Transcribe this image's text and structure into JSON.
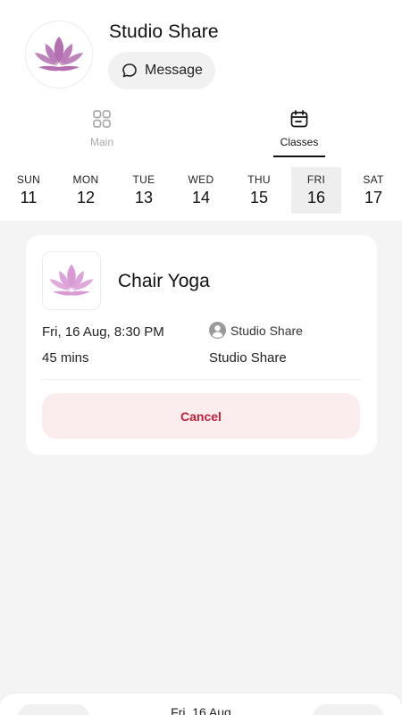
{
  "header": {
    "studio_name": "Studio Share",
    "message_label": "Message"
  },
  "tabs": [
    {
      "label": "Main",
      "icon": "grid-icon",
      "active": false
    },
    {
      "label": "Classes",
      "icon": "calendar-icon",
      "active": true
    }
  ],
  "week": [
    {
      "day": "SUN",
      "date": "11"
    },
    {
      "day": "MON",
      "date": "12"
    },
    {
      "day": "TUE",
      "date": "13"
    },
    {
      "day": "WED",
      "date": "14"
    },
    {
      "day": "THU",
      "date": "15"
    },
    {
      "day": "FRI",
      "date": "16",
      "selected": true
    },
    {
      "day": "SAT",
      "date": "17"
    }
  ],
  "class_card": {
    "title": "Chair Yoga",
    "datetime": "Fri, 16 Aug, 8:30 PM",
    "duration": "45 mins",
    "instructor": "Studio Share",
    "location": "Studio Share",
    "cancel_label": "Cancel"
  },
  "bottom_sheet": {
    "date": "Fri, 16 Aug"
  },
  "colors": {
    "brand_lotus": "#b36fb0",
    "cancel_text": "#c0213a",
    "cancel_bg": "#fbeded",
    "selected_day_bg": "#eeeeee"
  }
}
